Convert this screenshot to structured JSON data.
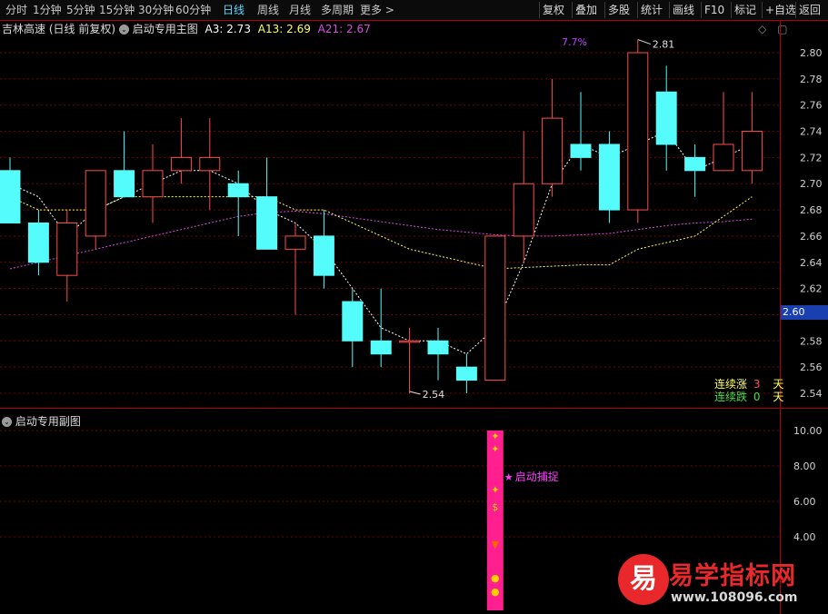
{
  "toolbar": {
    "timeframes": [
      "分时",
      "1分钟",
      "5分钟",
      "15分钟",
      "30分钟",
      "60分钟",
      "日线",
      "周线",
      "月线",
      "多周期",
      "更多 >"
    ],
    "active_timeframe": "日线",
    "buttons": [
      "复权",
      "叠加",
      "多股",
      "统计",
      "画线",
      "F10",
      "标记",
      "+自选",
      "返回"
    ]
  },
  "info": {
    "stock_name": "吉林高速",
    "period_mode": "(日线 前复权)",
    "indicator_name": "启动专用主图",
    "a3": "A3: 2.73",
    "a13": "A13: 2.69",
    "a21": "A21: 2.67"
  },
  "colors": {
    "up": "#ff4c4c",
    "down": "#54fcfc",
    "ma3": "#ffffff",
    "ma13": "#ffff54",
    "ma21": "#d84be0",
    "grid": "#7a0000",
    "pink": "#ff1f8f"
  },
  "annotations": {
    "top_pct": "7.7%",
    "high_label": "2.81",
    "low_label": "2.54",
    "price_badge": "2.60"
  },
  "legend": {
    "rise_label": "连续涨",
    "rise_count": "3",
    "fall_label": "连续跌",
    "fall_count": "0",
    "unit": "天"
  },
  "subchart": {
    "title": "启动专用副图",
    "signal_text": "启动捕捉",
    "yticks": [
      "10.00",
      "8.00",
      "6.00",
      "4.00"
    ]
  },
  "watermark": {
    "logo_char": "易",
    "title": "易学指标网",
    "url": "www.108096.com"
  },
  "chart_data": {
    "type": "candlestick",
    "ylim": [
      2.53,
      2.82
    ],
    "yticks": [
      2.8,
      2.78,
      2.76,
      2.74,
      2.72,
      2.7,
      2.68,
      2.66,
      2.64,
      2.62,
      2.6,
      2.58,
      2.56,
      2.54
    ],
    "ohlc": [
      [
        2.71,
        2.72,
        2.67,
        2.67
      ],
      [
        2.67,
        2.68,
        2.63,
        2.64
      ],
      [
        2.63,
        2.68,
        2.61,
        2.67
      ],
      [
        2.66,
        2.71,
        2.65,
        2.71
      ],
      [
        2.71,
        2.74,
        2.69,
        2.69
      ],
      [
        2.69,
        2.73,
        2.67,
        2.71
      ],
      [
        2.71,
        2.75,
        2.7,
        2.72
      ],
      [
        2.71,
        2.75,
        2.68,
        2.72
      ],
      [
        2.7,
        2.71,
        2.66,
        2.69
      ],
      [
        2.69,
        2.72,
        2.65,
        2.65
      ],
      [
        2.65,
        2.67,
        2.6,
        2.66
      ],
      [
        2.66,
        2.68,
        2.62,
        2.63
      ],
      [
        2.61,
        2.62,
        2.56,
        2.58
      ],
      [
        2.58,
        2.62,
        2.56,
        2.57
      ],
      [
        2.58,
        2.59,
        2.54,
        2.58
      ],
      [
        2.58,
        2.59,
        2.55,
        2.57
      ],
      [
        2.56,
        2.57,
        2.54,
        2.55
      ],
      [
        2.55,
        2.66,
        2.55,
        2.66
      ],
      [
        2.66,
        2.74,
        2.64,
        2.7
      ],
      [
        2.7,
        2.78,
        2.69,
        2.75
      ],
      [
        2.73,
        2.77,
        2.71,
        2.72
      ],
      [
        2.73,
        2.74,
        2.67,
        2.68
      ],
      [
        2.68,
        2.81,
        2.67,
        2.8
      ],
      [
        2.77,
        2.79,
        2.71,
        2.73
      ],
      [
        2.72,
        2.73,
        2.69,
        2.71
      ],
      [
        2.71,
        2.77,
        2.71,
        2.73
      ],
      [
        2.71,
        2.77,
        2.7,
        2.74
      ]
    ],
    "ma3": [
      2.7,
      2.69,
      2.66,
      2.68,
      2.69,
      2.7,
      2.71,
      2.71,
      2.7,
      2.68,
      2.67,
      2.65,
      2.62,
      2.59,
      2.58,
      2.58,
      2.57,
      2.59,
      2.64,
      2.7,
      2.73,
      2.72,
      2.73,
      2.74,
      2.71,
      2.72,
      2.73
    ],
    "ma13": [
      2.69,
      2.68,
      2.68,
      2.68,
      2.69,
      2.69,
      2.69,
      2.69,
      2.69,
      2.69,
      2.68,
      2.68,
      2.67,
      2.66,
      2.65,
      2.645,
      2.64,
      2.635,
      2.636,
      2.637,
      2.638,
      2.638,
      2.65,
      2.655,
      2.66,
      2.675,
      2.69
    ],
    "ma21": [
      2.635,
      2.64,
      2.645,
      2.65,
      2.655,
      2.66,
      2.665,
      2.67,
      2.675,
      2.678,
      2.679,
      2.677,
      2.674,
      2.671,
      2.668,
      2.665,
      2.663,
      2.661,
      2.66,
      2.66,
      2.661,
      2.662,
      2.665,
      2.668,
      2.67,
      2.671,
      2.673
    ],
    "sub_ylim": [
      1.0,
      11.0
    ],
    "sub_yticks": [
      10,
      8,
      6,
      4
    ],
    "signal_index": 17,
    "signal_range": [
      0.0,
      10.0
    ]
  }
}
